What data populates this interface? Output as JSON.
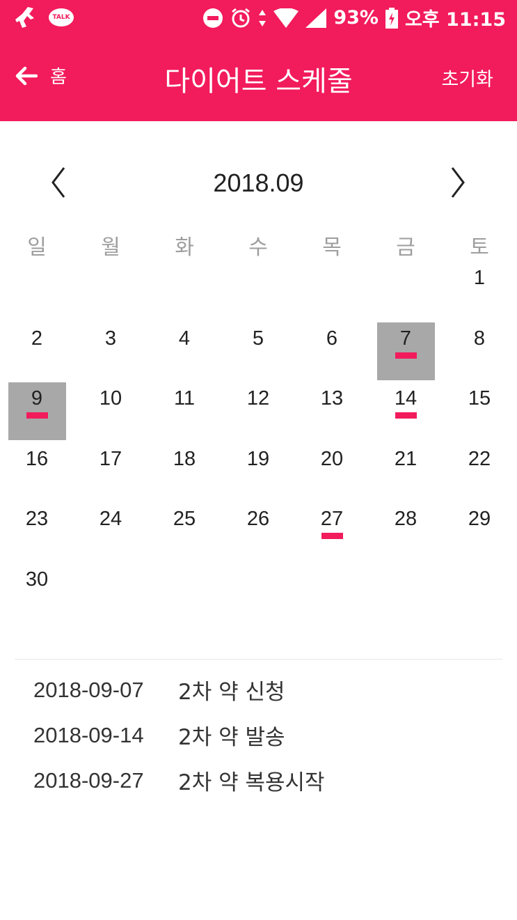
{
  "status_bar": {
    "talk_label": "TALK",
    "battery": "93%",
    "time": "오후 11:15"
  },
  "toolbar": {
    "back_label": "홈",
    "title": "다이어트 스케줄",
    "reset_label": "초기화"
  },
  "calendar": {
    "month_label": "2018.09",
    "weekdays": [
      "일",
      "월",
      "화",
      "수",
      "목",
      "금",
      "토"
    ],
    "weeks": [
      [
        "",
        "",
        "",
        "",
        "",
        "",
        "1"
      ],
      [
        "2",
        "3",
        "4",
        "5",
        "6",
        "7",
        "8"
      ],
      [
        "9",
        "10",
        "11",
        "12",
        "13",
        "14",
        "15"
      ],
      [
        "16",
        "17",
        "18",
        "19",
        "20",
        "21",
        "22"
      ],
      [
        "23",
        "24",
        "25",
        "26",
        "27",
        "28",
        "29"
      ],
      [
        "30",
        "",
        "",
        "",
        "",
        "",
        ""
      ]
    ],
    "selected_days": [
      "7",
      "9"
    ],
    "marked_days": [
      "7",
      "9",
      "14",
      "27"
    ]
  },
  "events": [
    {
      "date": "2018-09-07",
      "text": "2차 약 신청"
    },
    {
      "date": "2018-09-14",
      "text": "2차 약 발송"
    },
    {
      "date": "2018-09-27",
      "text": "2차 약 복용시작"
    }
  ],
  "colors": {
    "accent": "#f21b5c",
    "selected_bg": "#a8a8a8"
  }
}
